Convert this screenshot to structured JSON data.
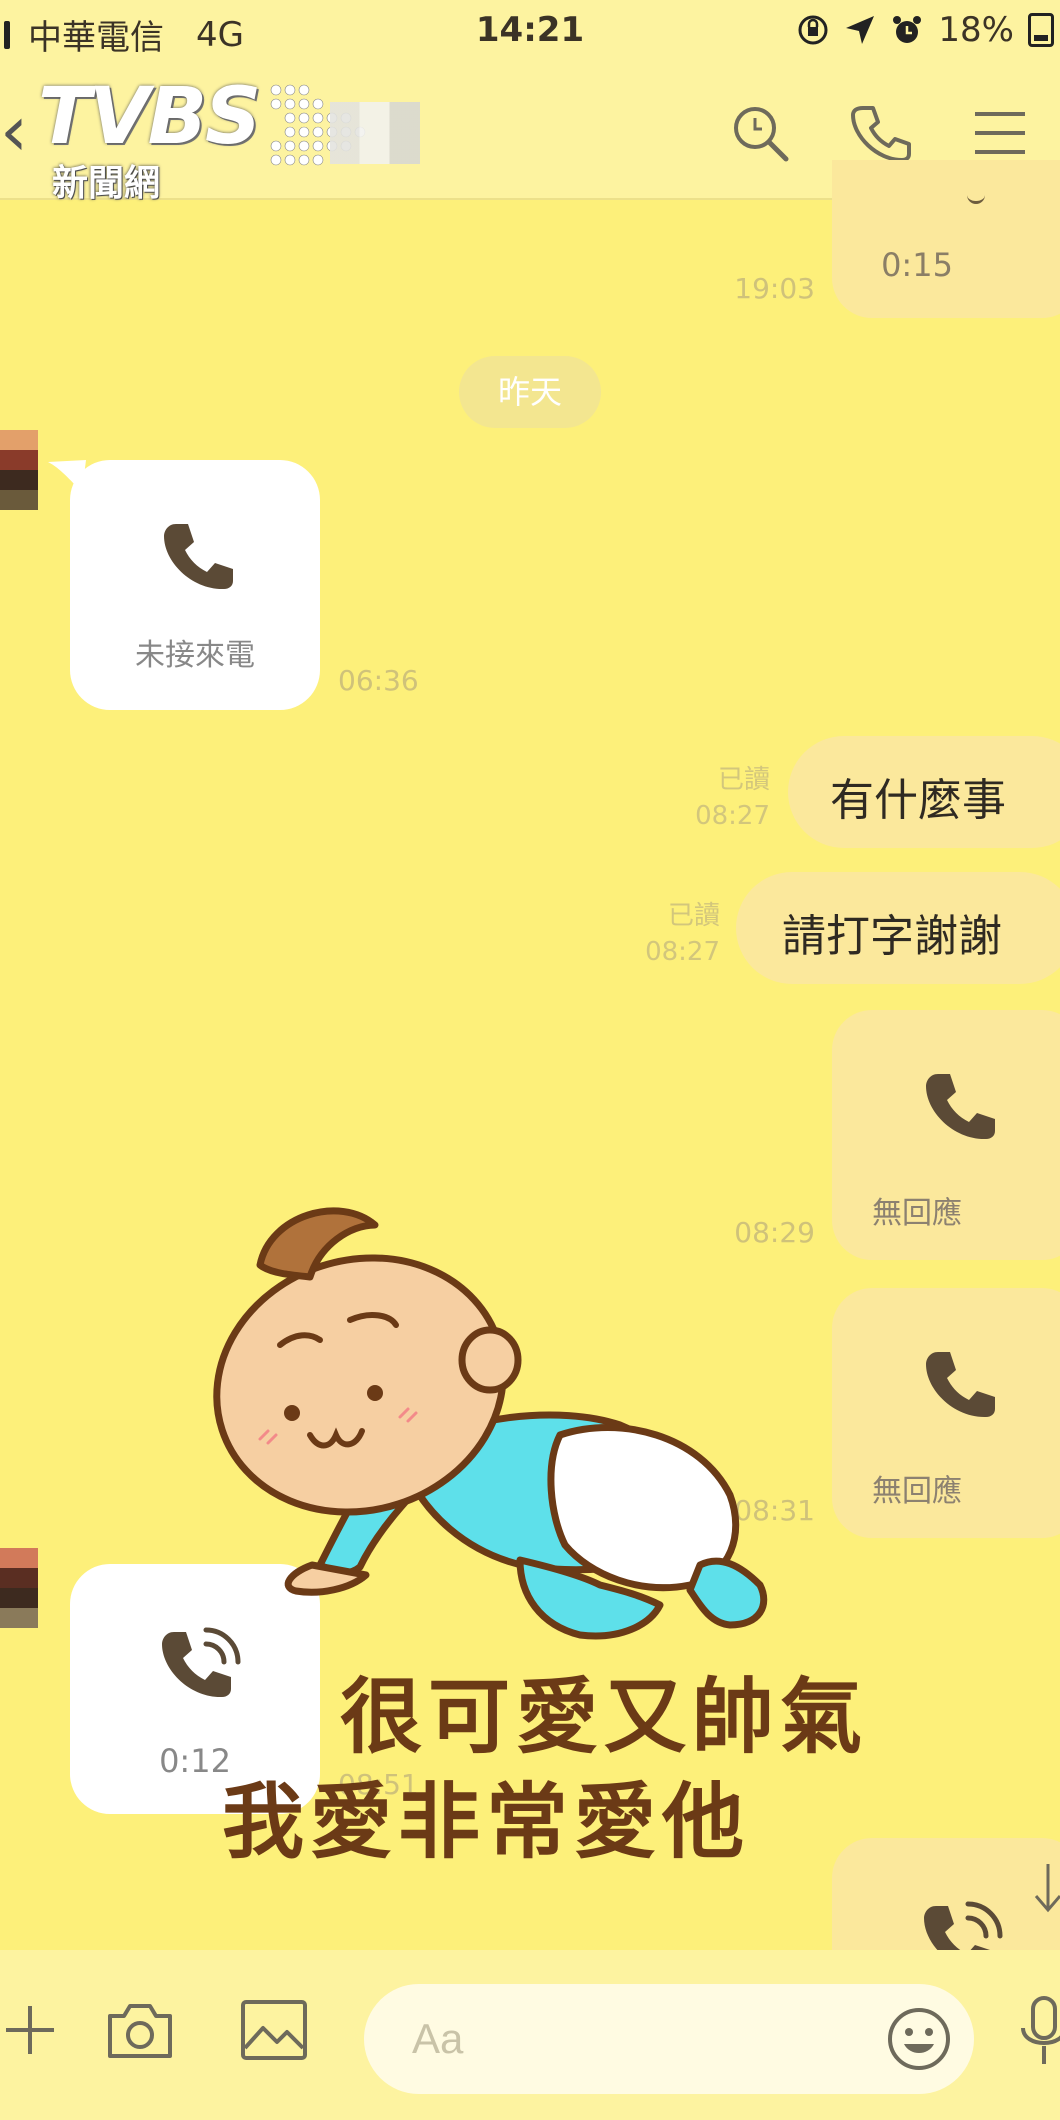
{
  "status_bar": {
    "carrier": "中華電信",
    "network": "4G",
    "time": "14:21",
    "battery": "18%"
  },
  "header": {
    "watermark_title": "TVBS",
    "watermark_subtitle": "新聞網",
    "icons": [
      "search-icon",
      "phone-icon",
      "menu-icon"
    ]
  },
  "messages": {
    "top_call_duration": "0:15",
    "top_time": "19:03",
    "date_separator": "昨天",
    "missed_call_label": "未接來電",
    "missed_call_time": "06:36",
    "msg1_text": "有什麼事",
    "msg1_read": "已讀",
    "msg1_time": "08:27",
    "msg2_text": "請打字謝謝",
    "msg2_read": "已讀",
    "msg2_time": "08:27",
    "no_answer1_label": "無回應",
    "no_answer1_time": "08:29",
    "no_answer2_label": "無回應",
    "no_answer2_time": "08:31",
    "in_call_duration": "0:12",
    "in_call_time": "08:51"
  },
  "sticker": {
    "line1": "很可愛又帥氣",
    "line2": "我愛非常愛他"
  },
  "input": {
    "placeholder": "Aa"
  },
  "colors": {
    "chat_background": "#fdf07a",
    "outgoing_bubble": "#fbe89c",
    "incoming_bubble": "#ffffff",
    "header_background": "#fdf3a0"
  }
}
